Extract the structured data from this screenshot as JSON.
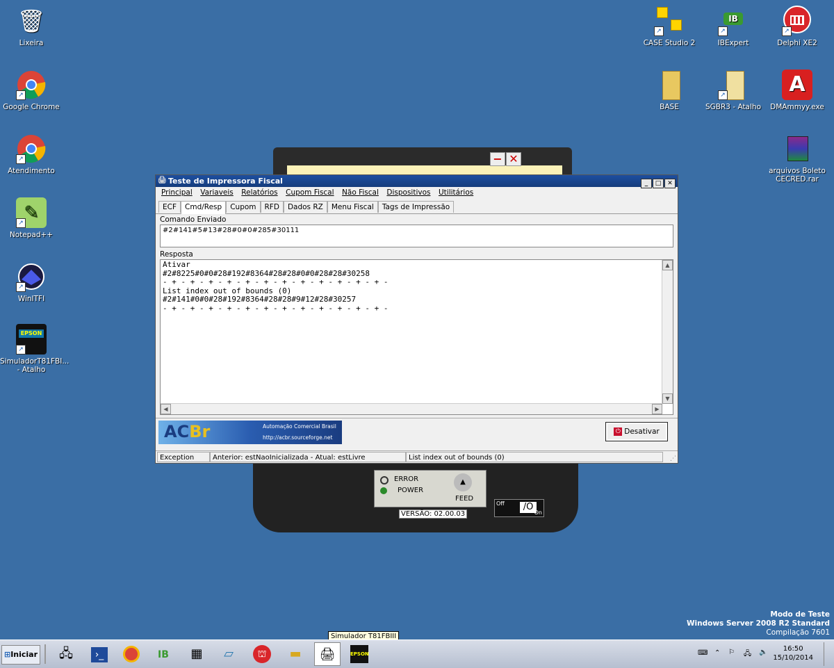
{
  "desktop_left": [
    {
      "label": "Lixeira",
      "icon": "recycle-bin-icon",
      "glyph": "🗑"
    },
    {
      "label": "Google Chrome",
      "icon": "chrome-icon",
      "glyph": "◉"
    },
    {
      "label": "Atendimento",
      "icon": "chrome-icon",
      "glyph": "◉"
    },
    {
      "label": "Notepad++",
      "icon": "notepadpp-icon",
      "glyph": "✎"
    },
    {
      "label": "WinITFI",
      "icon": "winitfi-icon",
      "glyph": "◍"
    },
    {
      "label": "SimuladorT81FBI... - Atalho",
      "icon": "epson-icon",
      "glyph": "EPSON"
    }
  ],
  "desktop_right": [
    {
      "label": "CASE Studio 2",
      "icon": "case-studio-icon",
      "glyph": "▣"
    },
    {
      "label": "IBExpert",
      "icon": "ibexpert-icon",
      "glyph": "IB"
    },
    {
      "label": "Delphi XE2",
      "icon": "delphi-icon",
      "glyph": "⛫"
    },
    {
      "label": "BASE",
      "icon": "folder-icon",
      "glyph": "📁"
    },
    {
      "label": "SGBR3 - Atalho",
      "icon": "folder-icon",
      "glyph": "📁"
    },
    {
      "label": "DMAmmyy.exe",
      "icon": "ammyy-icon",
      "glyph": "A"
    },
    {
      "label": "arquivos Boleto CECRED.rar",
      "icon": "winrar-icon",
      "glyph": "▤"
    }
  ],
  "printer": {
    "error_label": "ERROR",
    "power_label": "POWER",
    "feed_label": "FEED",
    "version": "VERSÃO: 02.00.03",
    "off_label": "Off",
    "on_label": "On"
  },
  "window": {
    "title": "Teste de Impressora Fiscal",
    "menu": [
      "Principal",
      "Variaveis",
      "Relatórios",
      "Cupom Fiscal",
      "Não Fiscal",
      "Dispositivos",
      "Utilitários"
    ],
    "tabs": [
      "ECF",
      "Cmd/Resp",
      "Cupom",
      "RFD",
      "Dados RZ",
      "Menu Fiscal",
      "Tags de Impressão"
    ],
    "active_tab": "Cmd/Resp",
    "comando_label": "Comando Enviado",
    "comando_value": "#2#141#5#13#28#0#0#285#30111",
    "resposta_label": "Resposta",
    "resposta_lines": [
      "Ativar",
      "#2#8225#0#0#28#192#8364#28#28#0#0#28#28#30258",
      "- + - + - + - + - + - + - + - + - + - + - + - + -",
      "List index out of bounds (0)",
      "#2#141#0#0#28#192#8364#28#28#9#12#28#30257",
      "- + - + - + - + - + - + - + - + - + - + - + - + -"
    ],
    "banner_logo_ac": "AC",
    "banner_logo_br": "Br",
    "banner_text": "Automação Comercial Brasil",
    "banner_url": "http://acbr.sourceforge.net",
    "desativar_label": "Desativar",
    "status": [
      "Exception",
      "Anterior: estNaoInicializada - Atual: estLivre",
      "List index out of bounds (0)"
    ]
  },
  "watermark": {
    "line1": "Modo de Teste",
    "line2": "Windows Server 2008 R2 Standard",
    "line3": "Compilação 7601"
  },
  "taskbar": {
    "start_label": "Iniciar",
    "tooltip": "Simulador T81FBIII",
    "time": "16:50",
    "date": "15/10/2014"
  }
}
